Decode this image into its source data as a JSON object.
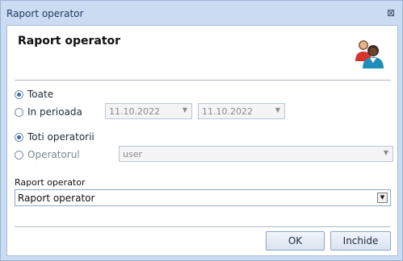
{
  "window": {
    "title": "Raport operator",
    "close_glyph": "⊠"
  },
  "header": {
    "title": "Raport operator",
    "icon": "users-icon"
  },
  "period": {
    "options": [
      {
        "label": "Toate",
        "checked": true
      },
      {
        "label": "In perioada",
        "checked": false
      }
    ],
    "from_date": "11.10.2022",
    "to_date": "11.10.2022"
  },
  "operators": {
    "options": [
      {
        "label": "Toti operatorii",
        "checked": true
      },
      {
        "label": "Operatorul",
        "checked": false
      }
    ],
    "operator_value": "user"
  },
  "report": {
    "label": "Raport operator",
    "value": "Raport operator"
  },
  "buttons": {
    "ok": "OK",
    "close": "Inchide"
  },
  "colors": {
    "accent": "#3a6ec0",
    "titlebar": "#c9dcf2"
  }
}
